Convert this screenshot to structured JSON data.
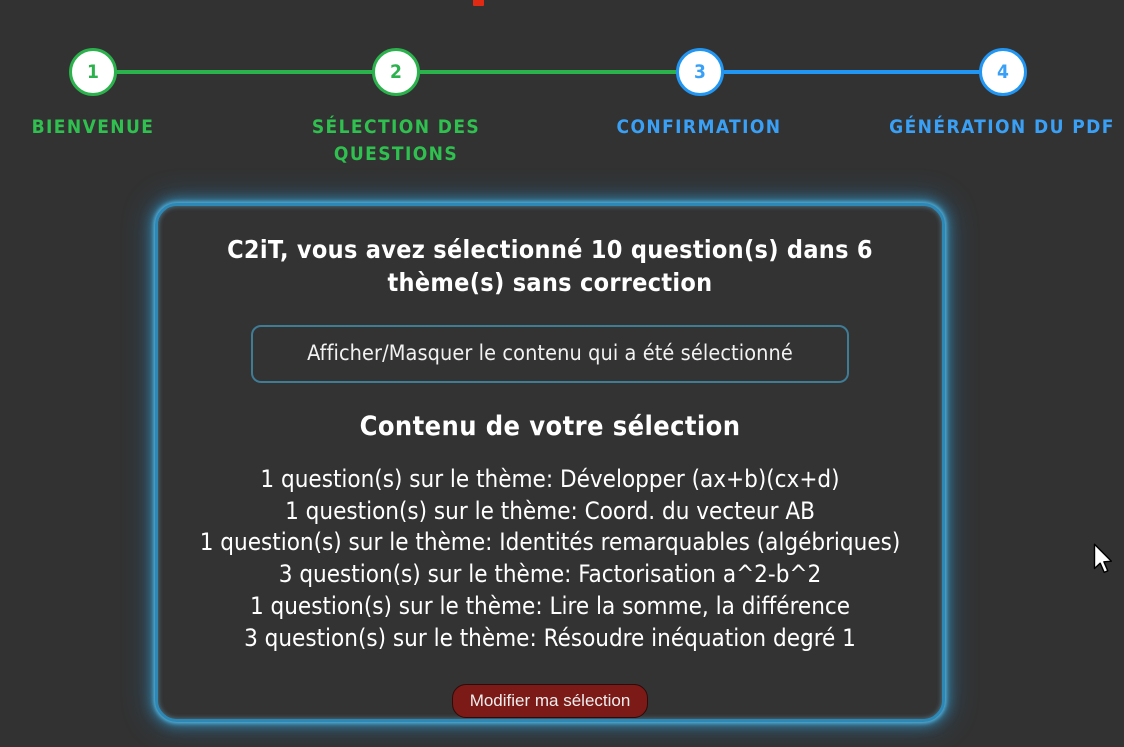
{
  "colors": {
    "page_background": "#323232",
    "card_background": "#333333",
    "step_done": "#2bb24c",
    "step_current": "#2196f3",
    "card_glow": "#3aa0e0",
    "toggle_border": "#3f7c96",
    "modify_button_background": "#7b1a16",
    "top_marker": "#e12a14"
  },
  "top_marker": {
    "name": "red-marker"
  },
  "stepper": {
    "steps": [
      {
        "number": "1",
        "label": "BIENVENUE",
        "state": "done",
        "color": "#2fc04f"
      },
      {
        "number": "2",
        "label": "SÉLECTION DES QUESTIONS",
        "state": "done",
        "color": "#2fc04f"
      },
      {
        "number": "3",
        "label": "CONFIRMATION",
        "state": "current",
        "color": "#3aa0f5"
      },
      {
        "number": "4",
        "label": "GÉNÉRATION DU PDF",
        "state": "upcoming",
        "color": "#3aa0f5"
      }
    ]
  },
  "card": {
    "heading": "C2iT, vous avez sélectionné 10 question(s) dans 6 thème(s) sans correction",
    "user_name": "C2iT",
    "question_count": "10",
    "theme_count": "6",
    "correction_state": "sans correction",
    "toggle_button_label": "Afficher/Masquer le contenu qui a été sélectionné",
    "selection_title": "Contenu de votre sélection",
    "themes": [
      "1 question(s) sur le thème: Développer (ax+b)(cx+d)",
      "1 question(s) sur le thème: Coord. du vecteur AB",
      "1 question(s) sur le thème: Identités remarquables (algébriques)",
      "3 question(s) sur le thème: Factorisation a^2-b^2",
      "1 question(s) sur le thème: Lire la somme, la différence",
      "3 question(s) sur le thème: Résoudre inéquation degré 1"
    ],
    "modify_button_label": "Modifier ma sélection"
  },
  "cursor": {
    "name": "mouse-pointer"
  }
}
